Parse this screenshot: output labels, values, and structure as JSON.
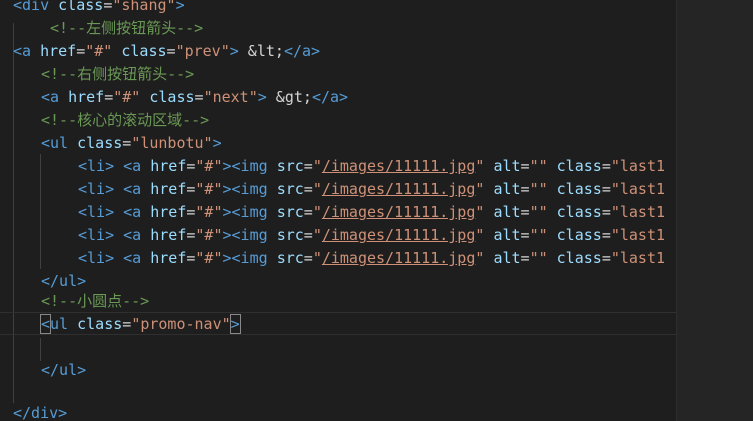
{
  "code": {
    "line_outer_open": [
      "<div ",
      "class",
      "=",
      "\"shang\"",
      ">"
    ],
    "comment_left": "<!--左侧按钮箭头-->",
    "prev_link": [
      "<a ",
      "href",
      "=",
      "\"#\"",
      " ",
      "class",
      "=",
      "\"prev\"",
      ">",
      " &lt;",
      "</a>"
    ],
    "comment_right": "<!--右侧按钮箭头-->",
    "next_link": [
      "<a ",
      "href",
      "=",
      "\"#\"",
      " ",
      "class",
      "=",
      "\"next\"",
      ">",
      " &gt;",
      "</a>"
    ],
    "comment_core": "<!--核心的滚动区域-->",
    "ul_open": [
      "<ul ",
      "class",
      "=",
      "\"lunbotu\"",
      ">"
    ],
    "li_items": [
      {
        "li_tag": "<li>",
        "a_tag": "<a ",
        "href_attr": "href",
        "href_val": "\"#\"",
        "img_tag": "><img ",
        "src_attr": "src",
        "src_q1": "\"",
        "src_val": "/images/11111.jpg",
        "src_q2": "\"",
        "alt_attr": "alt",
        "alt_val": "\"\"",
        "class_attr": "class",
        "class_val": "\"last1"
      },
      {
        "li_tag": "<li>",
        "a_tag": "<a ",
        "href_attr": "href",
        "href_val": "\"#\"",
        "img_tag": "><img ",
        "src_attr": "src",
        "src_q1": "\"",
        "src_val": "/images/11111.jpg",
        "src_q2": "\"",
        "alt_attr": "alt",
        "alt_val": "\"\"",
        "class_attr": "class",
        "class_val": "\"last1"
      },
      {
        "li_tag": "<li>",
        "a_tag": "<a ",
        "href_attr": "href",
        "href_val": "\"#\"",
        "img_tag": "><img ",
        "src_attr": "src",
        "src_q1": "\"",
        "src_val": "/images/11111.jpg",
        "src_q2": "\"",
        "alt_attr": "alt",
        "alt_val": "\"\"",
        "class_attr": "class",
        "class_val": "\"last1"
      },
      {
        "li_tag": "<li>",
        "a_tag": "<a ",
        "href_attr": "href",
        "href_val": "\"#\"",
        "img_tag": "><img ",
        "src_attr": "src",
        "src_q1": "\"",
        "src_val": "/images/11111.jpg",
        "src_q2": "\"",
        "alt_attr": "alt",
        "alt_val": "\"\"",
        "class_attr": "class",
        "class_val": "\"last1"
      },
      {
        "li_tag": "<li>",
        "a_tag": "<a ",
        "href_attr": "href",
        "href_val": "\"#\"",
        "img_tag": "><img ",
        "src_attr": "src",
        "src_q1": "\"",
        "src_val": "/images/11111.jpg",
        "src_q2": "\"",
        "alt_attr": "alt",
        "alt_val": "\"\"",
        "class_attr": "class",
        "class_val": "\"last1"
      }
    ],
    "ul_close": "</ul>",
    "comment_dots": "<!--小圆点-->",
    "promo_open": [
      "<",
      "ul ",
      "class",
      "=",
      "\"promo-nav\"",
      ">"
    ],
    "promo_close": "</ul>",
    "div_close": "</div>"
  }
}
